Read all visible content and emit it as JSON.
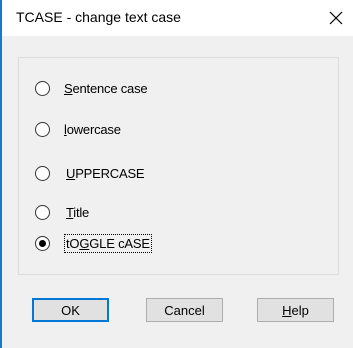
{
  "window": {
    "title": "TCASE - change text case",
    "close_icon": "close-icon"
  },
  "options": [
    {
      "id": "sentence",
      "pre": "",
      "mn": "S",
      "post": "entence case",
      "selected": false
    },
    {
      "id": "lower",
      "pre": "",
      "mn": "l",
      "post": "owercase",
      "selected": false
    },
    {
      "id": "upper",
      "pre": "",
      "mn": "U",
      "post": "PPERCASE",
      "selected": false
    },
    {
      "id": "title",
      "pre": "",
      "mn": "T",
      "post": "itle",
      "selected": false
    },
    {
      "id": "toggle",
      "pre": "tO",
      "mn": "G",
      "post": "GLE cASE",
      "selected": true
    }
  ],
  "buttons": {
    "ok": "OK",
    "cancel": "Cancel",
    "help_mn": "H",
    "help_rest": "elp"
  },
  "colors": {
    "accent": "#1979ca",
    "default_button_border": "#0078d7",
    "client_bg": "#f0f0f0"
  }
}
